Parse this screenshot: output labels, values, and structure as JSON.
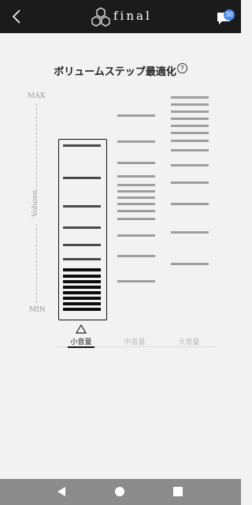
{
  "header": {
    "logo_text": "final",
    "chat_badge": "30"
  },
  "page": {
    "title": "ボリュームステップ最適化",
    "help_symbol": "?"
  },
  "axis": {
    "max_label": "MAX",
    "min_label": "MIN",
    "volume_label": "Volume"
  },
  "colors": {
    "selected_step": "#4a4a4a",
    "unselected_step": "#9e9e9e",
    "dense_step": "#0d0d0d"
  },
  "tabs": [
    {
      "label": "小音量",
      "active": true
    },
    {
      "label": "中音量",
      "active": false
    },
    {
      "label": "大音量",
      "active": false
    }
  ],
  "icons": {
    "back": "chevron-left-icon",
    "logo": "hexagon-logo-icon",
    "chat": "chat-bubble-icon",
    "help": "help-circle-icon",
    "selector": "triangle-icon"
  }
}
